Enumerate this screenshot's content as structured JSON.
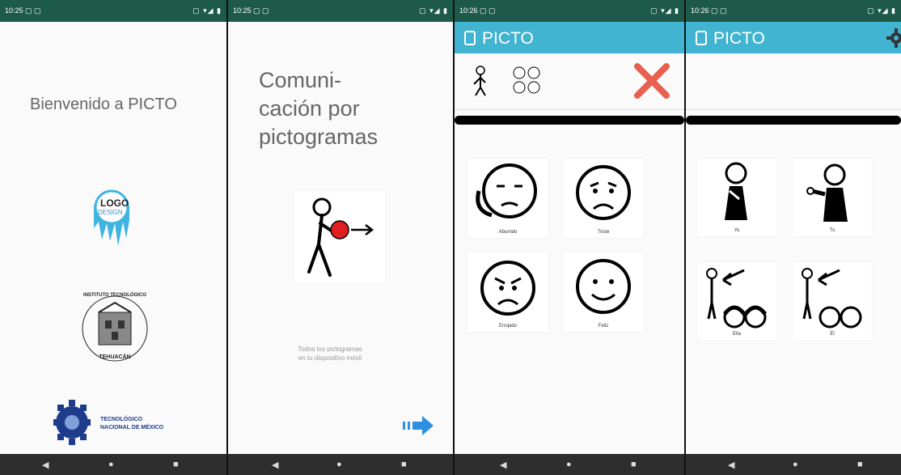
{
  "screens": [
    {
      "status": {
        "time": "10:25 ▢ ▢",
        "icons": "▢ ▾◢ ▮"
      },
      "welcome": "Bienvenido a PICTO",
      "logo1": {
        "word1": "LOGO",
        "word2": "DESIGN"
      },
      "logo2": {
        "top_text": "INSTITUTO TECNOLÓGICO",
        "bottom_text": "TEHUACÁN"
      },
      "logo3": {
        "line1": "TECNOLÓGICO",
        "line2": "NACIONAL DE MÉXICO"
      }
    },
    {
      "status": {
        "time": "10:25 ▢ ▢",
        "icons": "▢ ▾◢ ▮"
      },
      "heading_lines": [
        "Comuni-",
        "cación por",
        "pictogramas"
      ],
      "footer_lines": [
        "Todos los pictogramas",
        "en tu dispositivo móvil"
      ],
      "next_icon": "arrow-right-icon"
    },
    {
      "status": {
        "time": "10:26 ▢ ▢",
        "icons": "▢ ▾◢ ▮"
      },
      "app_title": "PICTO",
      "close_icon": "close-x-icon",
      "pictos": [
        {
          "label": "Aburrido",
          "face": "bored"
        },
        {
          "label": "Triste",
          "face": "sad"
        },
        {
          "label": "Enojado",
          "face": "angry"
        },
        {
          "label": "Feliz",
          "face": "happy"
        }
      ]
    },
    {
      "status": {
        "time": "10:26 ▢ ▢",
        "icons": "▢ ▾◢ ▮"
      },
      "app_title": "PICTO",
      "settings_icon": "gear-icon",
      "pictos": [
        {
          "label": "Yo"
        },
        {
          "label": "Tú"
        },
        {
          "label": "Ella"
        },
        {
          "label": "Él"
        }
      ]
    }
  ],
  "nav_buttons": {
    "back": "◀",
    "home": "●",
    "recents": "■"
  },
  "colors": {
    "status": "#1d5a4a",
    "appbar": "#40b4d0",
    "close": "#e8604f",
    "arrow": "#2e8fe0",
    "ball": "#e02020"
  }
}
